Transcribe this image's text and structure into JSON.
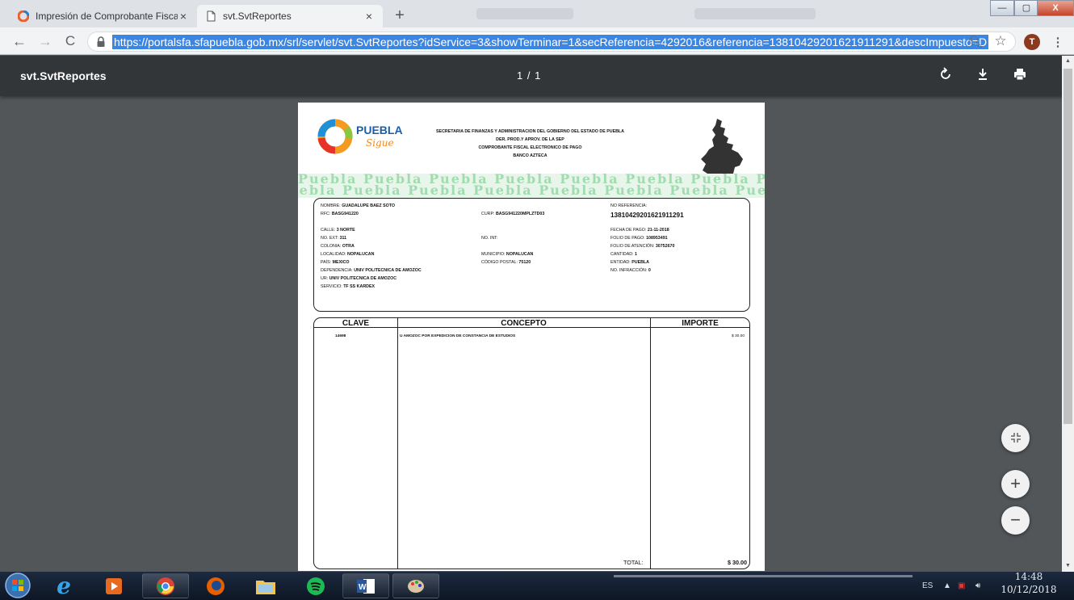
{
  "browser": {
    "tabs": [
      {
        "title": "Impresión de Comprobante Fisca",
        "close": "×",
        "active": false
      },
      {
        "title": "svt.SvtReportes",
        "close": "×",
        "active": true
      }
    ],
    "new_tab": "+",
    "url": "https://portalsfa.sfapuebla.gob.mx/srl/servlet/svt.SvtReportes?idService=3&showTerminar=1&secReferencia=4292016&referencia=13810429201621911291&descImpuesto=D",
    "profile_initial": "T",
    "window_controls": {
      "minimize": "—",
      "maximize": "▢",
      "close": "X"
    }
  },
  "viewer": {
    "doc_title": "svt.SvtReportes",
    "page_indicator": "1 / 1",
    "zoom_in": "+",
    "zoom_out": "−"
  },
  "document": {
    "logo_text": "PUEBLA",
    "logo_sub": "Sigue",
    "header": [
      "SECRETARIA DE FINANZAS Y ADMINISTRACION DEL GOBIERNO DEL ESTADO DE PUEBLA",
      "DER. PROD.Y APROV. DE LA SEP",
      "COMPROBANTE FISCAL ELECTRONICO DE PAGO",
      "BANCO AZTECA"
    ],
    "watermark_line": "Puebla Puebla Puebla Puebla Puebla Puebla Puebla Puebla",
    "fields": {
      "nombre_label": "NOMBRE:",
      "nombre": "GUADALUPE BAEZ SOTO",
      "rfc_label": "RFC:",
      "rfc": "BASG941220",
      "curp_label": "CURP:",
      "curp": "BASG941220MPLZTD03",
      "noref_label": "NO REFERENCIA:",
      "noref": "13810429201621911291",
      "calle_label": "CALLE:",
      "calle": "3 NORTE",
      "noext_label": "NO. EXT:",
      "noext": "311",
      "noint_label": "NO. INT:",
      "noint": "",
      "colonia_label": "COLONIA:",
      "colonia": "OTRA",
      "localidad_label": "LOCALIDAD:",
      "localidad": "NOPALUCAN",
      "municipio_label": "MUNICIPIO:",
      "municipio": "NOPALUCAN",
      "pais_label": "PAÍS:",
      "pais": "MEXICO",
      "cp_label": "CÓDIGO POSTAL:",
      "cp": "75120",
      "dependencia_label": "DEPENDENCIA:",
      "dependencia": "UNIV POLITECNICA DE AMOZOC",
      "ur_label": "UR:",
      "ur": "UNIV POLITECNICA DE AMOZOC",
      "servicio_label": "SERVICIO:",
      "servicio": "TF SS KARDEX",
      "fecha_label": "FECHA DE PAGO:",
      "fecha": "21-11-2018",
      "folio_pago_label": "FOLIO DE PAGO:",
      "folio_pago": "108953491",
      "folio_at_label": "FOLIO DE ATENCIÓN:",
      "folio_at": "30752670",
      "cantidad_label": "CANTIDAD:",
      "cantidad": "1",
      "entidad_label": "ENTIDAD:",
      "entidad": "PUEBLA",
      "infraccion_label": "NO. INFRACCIÓN:",
      "infraccion": "0"
    },
    "table": {
      "headers": [
        "CLAVE",
        "CONCEPTO",
        "IMPORTE"
      ],
      "rows": [
        {
          "clave": "14698",
          "concepto": "U AMOZOC POR EXPEDICION DE CONSTANCIA DE ESTUDIOS",
          "importe": "$ 30.00"
        }
      ],
      "total_label": "TOTAL:",
      "total": "$ 30.00"
    }
  },
  "taskbar": {
    "language": "ES",
    "time": "14:48",
    "date": "10/12/2018"
  },
  "colors": {
    "accent": "#3b86e3",
    "toolbar": "#323639",
    "viewer_bg": "#525659",
    "watermark": "#9fdcae"
  }
}
